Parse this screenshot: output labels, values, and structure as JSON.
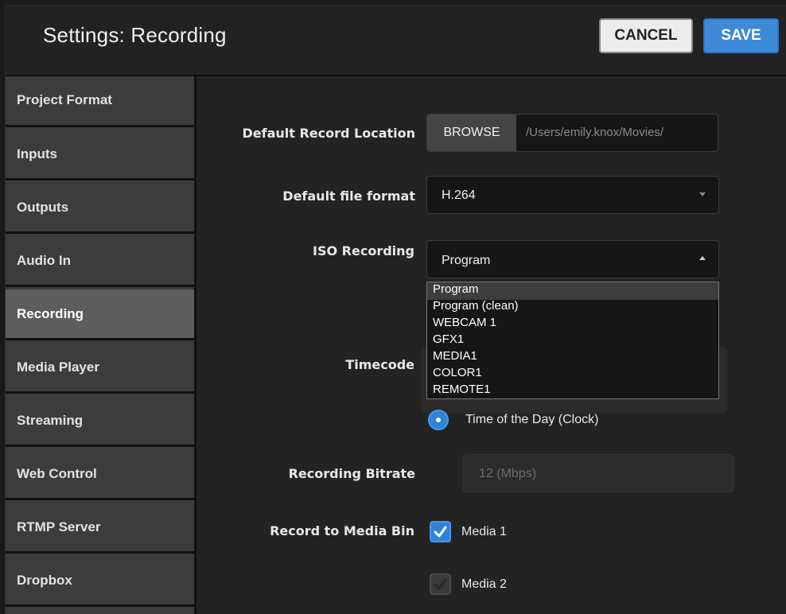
{
  "header": {
    "title": "Settings: Recording",
    "cancel_label": "CANCEL",
    "save_label": "SAVE"
  },
  "sidebar": {
    "items": [
      {
        "label": "Project Format"
      },
      {
        "label": "Inputs"
      },
      {
        "label": "Outputs"
      },
      {
        "label": "Audio In"
      },
      {
        "label": "Recording",
        "active": true
      },
      {
        "label": "Media Player"
      },
      {
        "label": "Streaming"
      },
      {
        "label": "Web Control"
      },
      {
        "label": "RTMP Server"
      },
      {
        "label": "Dropbox"
      }
    ]
  },
  "form": {
    "record_location": {
      "label": "Default Record Location",
      "browse_label": "BROWSE",
      "path": "/Users/emily.knox/Movies/"
    },
    "file_format": {
      "label": "Default file format",
      "value": "H.264",
      "icon": "chevron-down-icon"
    },
    "iso_recording": {
      "label": "ISO Recording",
      "value": "Program",
      "icon": "chevron-up-icon",
      "options": [
        "Program",
        "Program (clean)",
        "WEBCAM 1",
        "GFX1",
        "MEDIA1",
        "COLOR1",
        "REMOTE1"
      ],
      "selected_index": 0
    },
    "timecode": {
      "label": "Timecode",
      "option_label": "Time of the Day (Clock)"
    },
    "bitrate": {
      "label": "Recording Bitrate",
      "value": "12 (Mbps)"
    },
    "media_bin": {
      "label": "Record to Media Bin",
      "options": [
        {
          "label": "Media 1",
          "checked": true
        },
        {
          "label": "Media 2",
          "checked": false
        }
      ]
    }
  },
  "colors": {
    "accent": "#3f8ad8",
    "active_sidebar": "#5d5d5d"
  }
}
